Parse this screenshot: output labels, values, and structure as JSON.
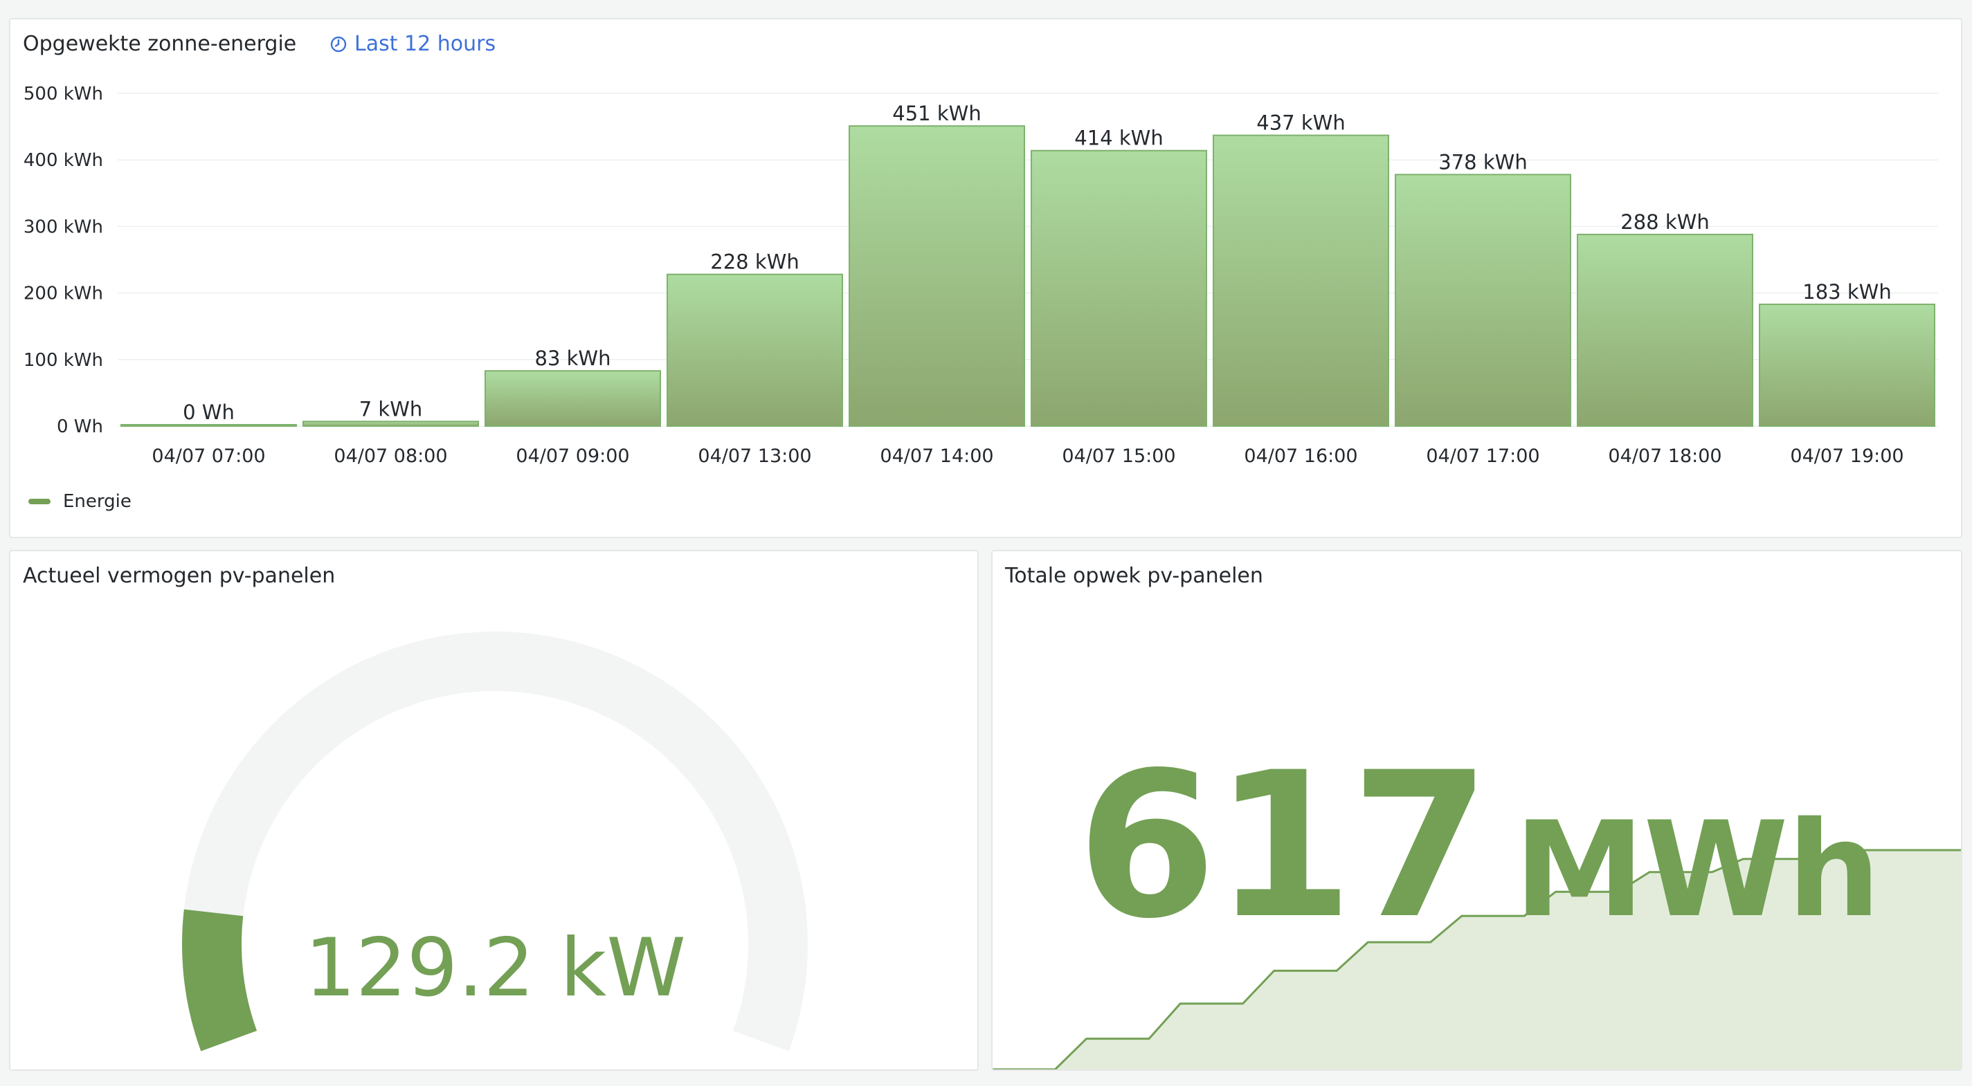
{
  "colors": {
    "accent": "#73a055",
    "bar_top": "#aedca1",
    "bar_bottom": "#8ca66e",
    "bar_border": "#7eb26d",
    "gauge_track": "#f3f4f4",
    "stat_area": "#e3ecdb",
    "time_range": "#3d71d9"
  },
  "bar_panel": {
    "title": "Opgewekte zonne-energie",
    "time_range_label": "Last 12 hours",
    "time_range_icon": "clock-icon"
  },
  "chart_data": {
    "type": "bar",
    "categories": [
      "04/07 07:00",
      "04/07 08:00",
      "04/07 09:00",
      "04/07 13:00",
      "04/07 14:00",
      "04/07 15:00",
      "04/07 16:00",
      "04/07 17:00",
      "04/07 18:00",
      "04/07 19:00"
    ],
    "series": [
      {
        "name": "Energie",
        "values": [
          0,
          7,
          83,
          228,
          451,
          414,
          437,
          378,
          288,
          183
        ],
        "labels": [
          "0 Wh",
          "7 kWh",
          "83 kWh",
          "228 kWh",
          "451 kWh",
          "414 kWh",
          "437 kWh",
          "378 kWh",
          "288 kWh",
          "183 kWh"
        ]
      }
    ],
    "ylim": [
      0,
      500
    ],
    "yticks": [
      0,
      100,
      200,
      300,
      400,
      500
    ],
    "ytick_labels": [
      "0 Wh",
      "100 kWh",
      "200 kWh",
      "300 kWh",
      "400 kWh",
      "500 kWh"
    ],
    "grid": true,
    "legend": "bottom-left"
  },
  "gauge_panel": {
    "title": "Actueel vermogen pv-panelen",
    "value_text": "129.2 kW",
    "fraction": 0.12
  },
  "stat_panel": {
    "title": "Totale opwek pv-panelen",
    "value": "617",
    "unit": "MWh",
    "sparkline": [
      0,
      0,
      0,
      0.14,
      0.14,
      0.14,
      0.3,
      0.3,
      0.3,
      0.45,
      0.45,
      0.45,
      0.58,
      0.58,
      0.58,
      0.7,
      0.7,
      0.7,
      0.81,
      0.81,
      0.81,
      0.9,
      0.9,
      0.9,
      0.96,
      0.96,
      0.96,
      1.0,
      1.0,
      1.0,
      1.0,
      1.0
    ]
  }
}
